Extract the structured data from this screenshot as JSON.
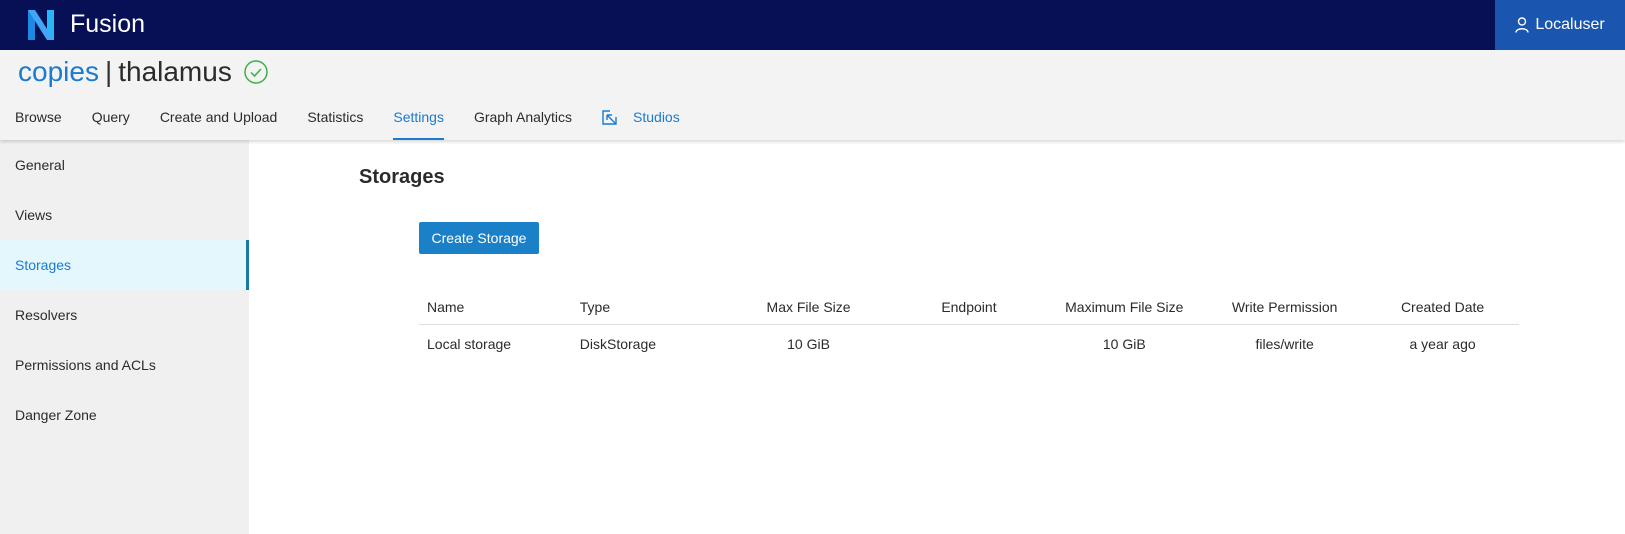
{
  "header": {
    "app_name": "Fusion",
    "user_label": "Localuser"
  },
  "title": {
    "repo": "copies",
    "separator": "|",
    "name": "thalamus",
    "status": "ok"
  },
  "tabs": [
    {
      "label": "Browse"
    },
    {
      "label": "Query"
    },
    {
      "label": "Create and Upload"
    },
    {
      "label": "Statistics"
    },
    {
      "label": "Settings",
      "active": true
    },
    {
      "label": "Graph Analytics"
    },
    {
      "label": "Studios"
    }
  ],
  "sidebar": {
    "items": [
      {
        "label": "General"
      },
      {
        "label": "Views"
      },
      {
        "label": "Storages",
        "active": true
      },
      {
        "label": "Resolvers"
      },
      {
        "label": "Permissions and ACLs"
      },
      {
        "label": "Danger Zone"
      }
    ]
  },
  "main": {
    "heading": "Storages",
    "create_button": "Create Storage",
    "table": {
      "columns": [
        "Name",
        "Type",
        "Max File Size",
        "Endpoint",
        "Maximum File Size",
        "Write Permission",
        "Created Date"
      ],
      "rows": [
        [
          "Local storage",
          "DiskStorage",
          "10 GiB",
          "",
          "10 GiB",
          "files/write",
          "a year ago"
        ]
      ]
    }
  },
  "colors": {
    "topbar": "#071055",
    "accent": "#1a7bd0",
    "button": "#1a80c8",
    "sidebar_active_bg": "#e3f7fc",
    "status_ok": "#3cb043"
  }
}
